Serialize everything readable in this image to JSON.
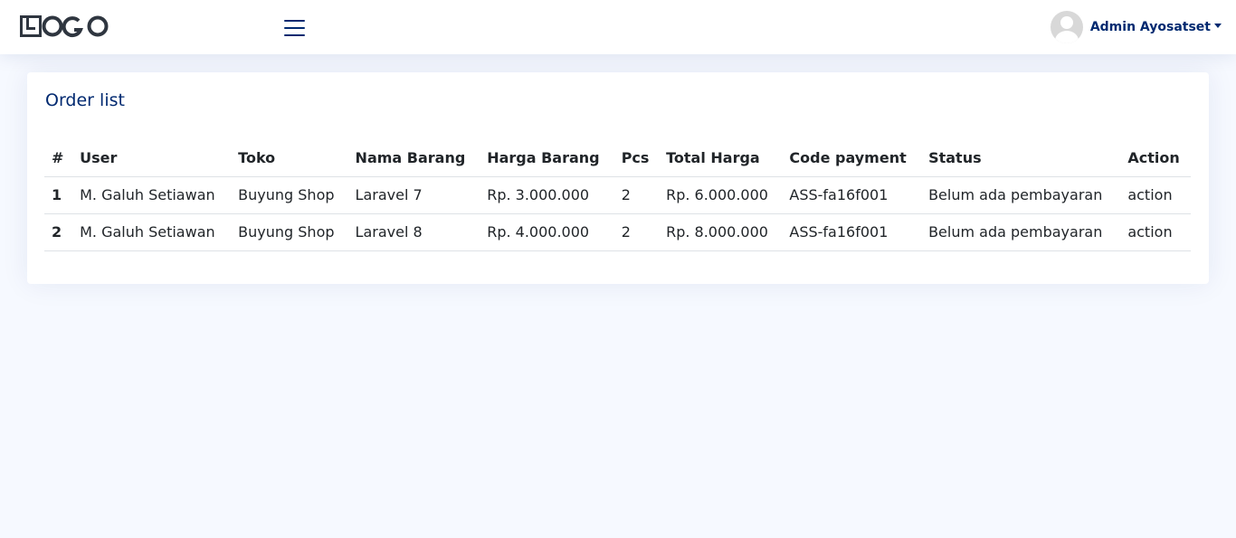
{
  "header": {
    "logo_text": "LOGO",
    "menu_icon": "hamburger-menu-icon",
    "user_name": "Admin Ayosatset",
    "avatar_icon": "user-avatar-icon"
  },
  "card": {
    "title": "Order list"
  },
  "table": {
    "columns": [
      "#",
      "User",
      "Toko",
      "Nama Barang",
      "Harga Barang",
      "Pcs",
      "Total Harga",
      "Code payment",
      "Status",
      "Action"
    ],
    "rows": [
      {
        "num": "1",
        "user": "M. Galuh Setiawan",
        "toko": "Buyung Shop",
        "nama": "Laravel 7",
        "harga": "Rp. 3.000.000",
        "pcs": "2",
        "total": "Rp. 6.000.000",
        "code": "ASS-fa16f001",
        "status": "Belum ada pembayaran",
        "action": "action"
      },
      {
        "num": "2",
        "user": "M. Galuh Setiawan",
        "toko": "Buyung Shop",
        "nama": "Laravel 8",
        "harga": "Rp. 4.000.000",
        "pcs": "2",
        "total": "Rp. 8.000.000",
        "code": "ASS-fa16f001",
        "status": "Belum ada pembayaran",
        "action": "action"
      }
    ]
  },
  "colors": {
    "accent": "#012970",
    "background": "#f6f9ff"
  }
}
